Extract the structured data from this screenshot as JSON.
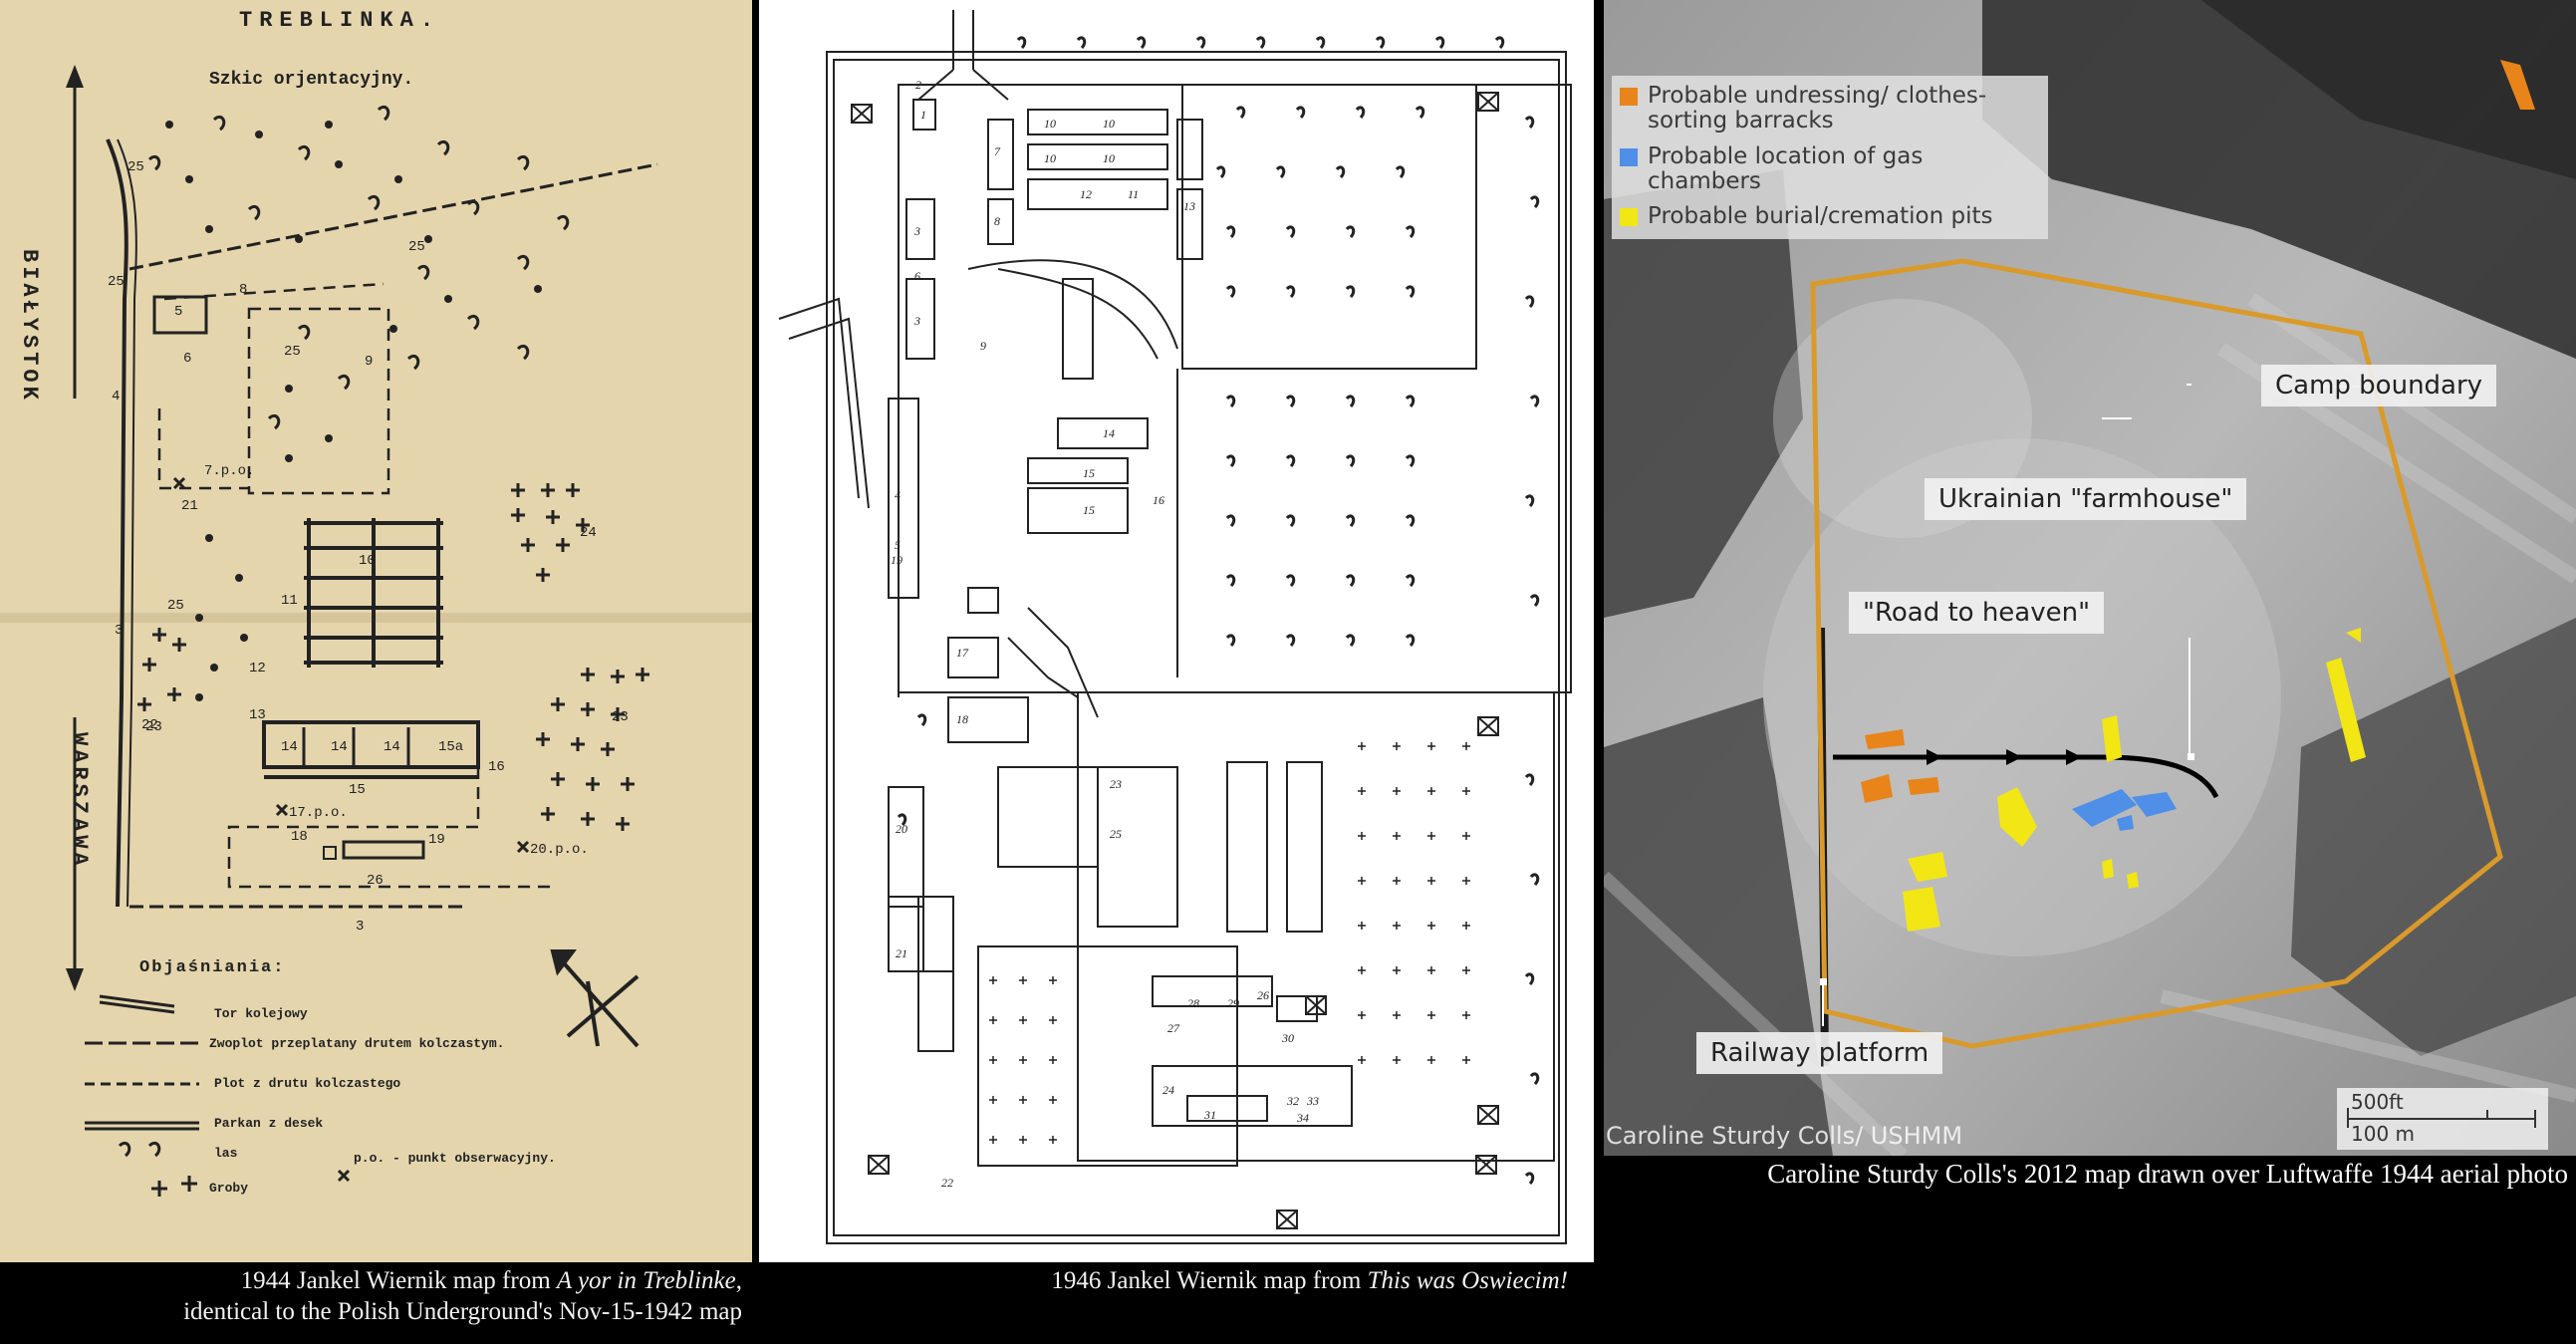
{
  "panel1": {
    "title": "TREBLINKA.",
    "subtitle": "Szkic orjentacyjny.",
    "places": {
      "north": "BIAŁYSTOK",
      "south": "WARSZAWA"
    },
    "numbers": [
      "25",
      "25",
      "25",
      "25",
      "25",
      "8",
      "5",
      "6",
      "4",
      "9",
      "7.p.o.",
      "21",
      "22",
      "10",
      "11",
      "3",
      "12",
      "13",
      "23",
      "23",
      "24",
      "14",
      "14",
      "14",
      "15a",
      "15",
      "16",
      "17.p.o.",
      "18",
      "19",
      "20.p.o.",
      "26",
      "3"
    ],
    "legend_title": "Objaśniania:",
    "legend": [
      "Tor kolejowy",
      "Zwoplot przeplatany drutem kolczastym.",
      "Plot z drutu kolczastego",
      "Parkan z desek",
      "las",
      "p.o. - punkt obserwacyjny.",
      "Groby"
    ],
    "caption_line1_prefix": "1944 Jankel Wiernik map from ",
    "caption_line1_title": "A yor in Treblinke",
    "caption_line1_suffix": ",",
    "caption_line2": "identical to the Polish Underground's Nov-15-1942 map"
  },
  "panel2": {
    "labels": [
      "1",
      "2",
      "3",
      "3",
      "4",
      "5",
      "6",
      "7",
      "8",
      "9",
      "10",
      "10",
      "10",
      "10",
      "11",
      "12",
      "13",
      "14",
      "15",
      "15",
      "16",
      "17",
      "18",
      "19",
      "20",
      "21",
      "22",
      "23",
      "24",
      "25",
      "26",
      "27",
      "28",
      "29",
      "30",
      "31",
      "32",
      "33",
      "34"
    ],
    "caption_prefix": "1946 Jankel Wiernik map from ",
    "caption_title": "This was Oswiecim!"
  },
  "panel3": {
    "legend": [
      {
        "label": "Probable undressing/ clothes-sorting barracks",
        "color": "#e8841a"
      },
      {
        "label": "Probable location of gas chambers",
        "color": "#4f8fe8"
      },
      {
        "label": "Probable burial/cremation pits",
        "color": "#f2e614"
      }
    ],
    "labels": {
      "camp_boundary": "Camp boundary",
      "farmhouse": "Ukrainian \"farmhouse\"",
      "road": "\"Road to heaven\"",
      "platform": "Railway platform"
    },
    "credit": "Caroline Sturdy Colls/ USHMM",
    "scale": {
      "ft": "500ft",
      "m": "100 m"
    },
    "boundary_color": "#d99a2b",
    "caption": "Caroline Sturdy Colls's 2012 map drawn over Luftwaffe 1944 aerial photo"
  }
}
